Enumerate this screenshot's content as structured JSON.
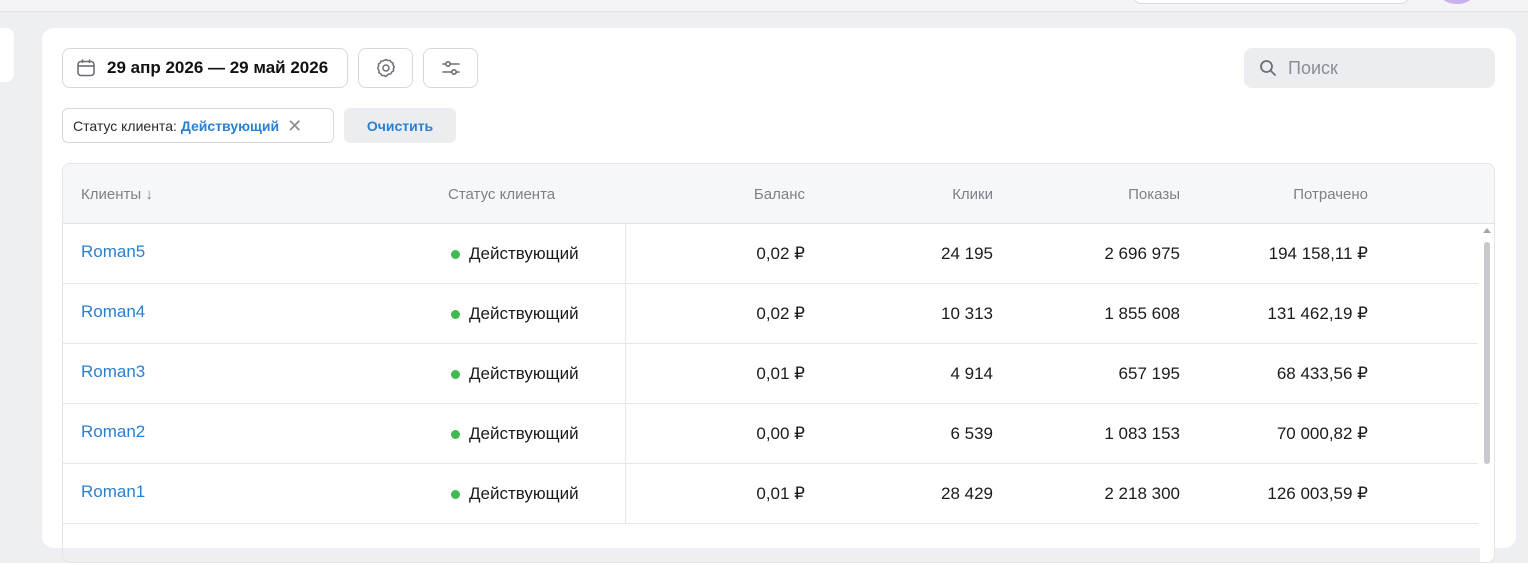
{
  "toolbar": {
    "date_range": "29 апр 2026 — 29 май 2026",
    "search_placeholder": "Поиск"
  },
  "filters": {
    "chip_key": "Статус клиента:",
    "chip_value": "Действующий",
    "clear_label": "Очистить"
  },
  "table": {
    "columns": [
      "Клиенты ↓",
      "Статус клиента",
      "Баланс",
      "Клики",
      "Показы",
      "Потрачено"
    ],
    "rows": [
      {
        "client": "Roman5",
        "status": "Действующий",
        "balance": "0,02 ₽",
        "clicks": "24 195",
        "shows": "2 696 975",
        "spent": "194 158,11 ₽"
      },
      {
        "client": "Roman4",
        "status": "Действующий",
        "balance": "0,02 ₽",
        "clicks": "10 313",
        "shows": "1 855 608",
        "spent": "131 462,19 ₽"
      },
      {
        "client": "Roman3",
        "status": "Действующий",
        "balance": "0,01 ₽",
        "clicks": "4 914",
        "shows": "657 195",
        "spent": "68 433,56 ₽"
      },
      {
        "client": "Roman2",
        "status": "Действующий",
        "balance": "0,00 ₽",
        "clicks": "6 539",
        "shows": "1 083 153",
        "spent": "70 000,82 ₽"
      },
      {
        "client": "Roman1",
        "status": "Действующий",
        "balance": "0,01 ₽",
        "clicks": "28 429",
        "shows": "2 218 300",
        "spent": "126 003,59 ₽"
      }
    ]
  },
  "colors": {
    "accent": "#2a7fd0",
    "status_active": "#3fb950"
  }
}
